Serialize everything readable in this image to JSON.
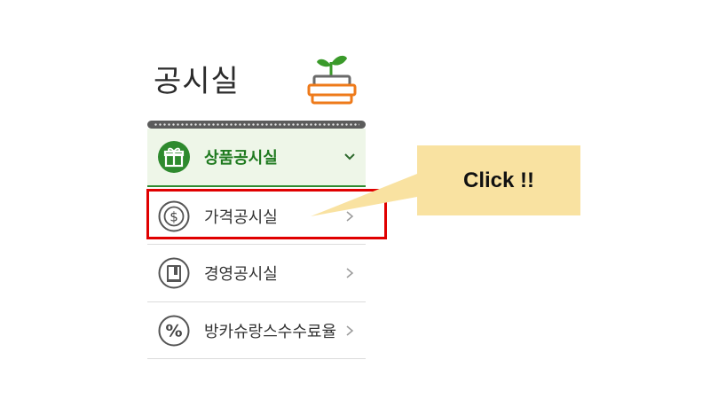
{
  "page": {
    "title": "공시실"
  },
  "menu": {
    "items": [
      {
        "label": "상품공시실",
        "icon": "gift-icon",
        "arrow": "chevron-down-icon",
        "active": true
      },
      {
        "label": "가격공시실",
        "icon": "dollar-coin-icon",
        "arrow": "chevron-right-icon",
        "active": false
      },
      {
        "label": "경영공시실",
        "icon": "book-icon",
        "arrow": "chevron-right-icon",
        "active": false
      },
      {
        "label": "방카슈랑스수수료율",
        "icon": "percent-icon",
        "arrow": "chevron-right-icon",
        "active": false
      }
    ]
  },
  "callout": {
    "text": "Click !!"
  },
  "colors": {
    "active_green": "#2e8a2e",
    "active_bg": "#eef6e8",
    "highlight_red": "#e00000",
    "callout_bg": "#f9e2a1"
  }
}
